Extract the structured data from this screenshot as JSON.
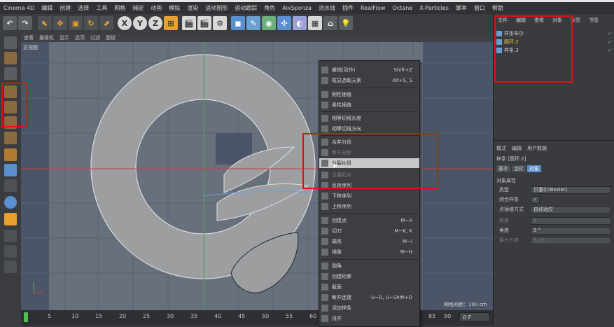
{
  "menubar": [
    "Cinema 4D",
    "编辑",
    "创建",
    "选择",
    "工具",
    "网格",
    "捕捉",
    "动画",
    "模拟",
    "渲染",
    "运动图形",
    "运动跟踪",
    "角色",
    "AixSponza",
    "流水线",
    "插件",
    "RealFlow",
    "Octane",
    "X-Particles",
    "脚本",
    "窗口",
    "帮助"
  ],
  "viewport": {
    "menu": [
      "查看",
      "摄像机",
      "显示",
      "选项",
      "过滤",
      "面板"
    ],
    "label": "正视图",
    "grid_distance": "网格间距：100 cm"
  },
  "timeline": {
    "ticks": [
      "0",
      "5",
      "10",
      "15",
      "20",
      "25",
      "30",
      "35",
      "40",
      "45",
      "50",
      "55",
      "60",
      "85",
      "90"
    ],
    "frame_value": "0 F"
  },
  "context_menu": {
    "items": [
      {
        "label": "撤销(动作)",
        "shortcut": "Shift+Z",
        "disabled": false
      },
      {
        "label": "框显选取元素",
        "shortcut": "Alt+S, S",
        "disabled": false
      },
      {
        "label": "刚性插值",
        "shortcut": "",
        "disabled": false
      },
      {
        "label": "柔性插值",
        "shortcut": "",
        "disabled": false
      },
      {
        "label": "相等切线长度",
        "shortcut": "",
        "disabled": false
      },
      {
        "label": "相等切线方向",
        "shortcut": "",
        "disabled": false
      },
      {
        "label": "合并分段",
        "shortcut": "",
        "disabled": false
      },
      {
        "label": "断开分段",
        "shortcut": "",
        "disabled": true
      },
      {
        "label": "分裂片段",
        "shortcut": "",
        "disabled": false
      },
      {
        "label": "设置起点",
        "shortcut": "",
        "disabled": true
      },
      {
        "label": "反转序列",
        "shortcut": "",
        "disabled": false
      },
      {
        "label": "下移序列",
        "shortcut": "",
        "disabled": false
      },
      {
        "label": "上移序列",
        "shortcut": "",
        "disabled": false
      },
      {
        "label": "创建点",
        "shortcut": "M~A",
        "disabled": false
      },
      {
        "label": "切刀",
        "shortcut": "M~K, K",
        "disabled": false
      },
      {
        "label": "磁铁",
        "shortcut": "M~I",
        "disabled": false
      },
      {
        "label": "镜像",
        "shortcut": "M~H",
        "disabled": false
      },
      {
        "label": "倒角",
        "shortcut": "",
        "disabled": false
      },
      {
        "label": "创建轮廓",
        "shortcut": "",
        "disabled": false
      },
      {
        "label": "截面",
        "shortcut": "",
        "disabled": false
      },
      {
        "label": "断开连接",
        "shortcut": "U~D, U~Shift+D",
        "disabled": false
      },
      {
        "label": "添加样条",
        "shortcut": "",
        "disabled": false
      },
      {
        "label": "排齐",
        "shortcut": "",
        "disabled": false
      }
    ]
  },
  "object_manager": {
    "tabs": [
      "文件",
      "编辑",
      "查看",
      "对象",
      "标签",
      "书签"
    ],
    "objects": [
      {
        "name": "样条布尔",
        "checks": "✓"
      },
      {
        "name": "圆环.2",
        "checks": "✓"
      },
      {
        "name": "样条.3",
        "checks": "✓"
      }
    ]
  },
  "attributes": {
    "tabs": [
      "模式",
      "编辑",
      "用户数据"
    ],
    "title": "样条 [圆环.2]",
    "subtabs": [
      "基本",
      "坐标",
      "对象"
    ],
    "section": "对象属性",
    "rows": [
      {
        "label": "类型",
        "value": "贝塞尔(Bezier)"
      },
      {
        "label": "闭合样条",
        "value": "✓"
      },
      {
        "label": "点插值方式",
        "value": "自动适应"
      },
      {
        "label": "数量",
        "value": "8"
      },
      {
        "label": "角度",
        "value": "5 °"
      },
      {
        "label": "最大长度",
        "value": "5 cm"
      }
    ]
  }
}
